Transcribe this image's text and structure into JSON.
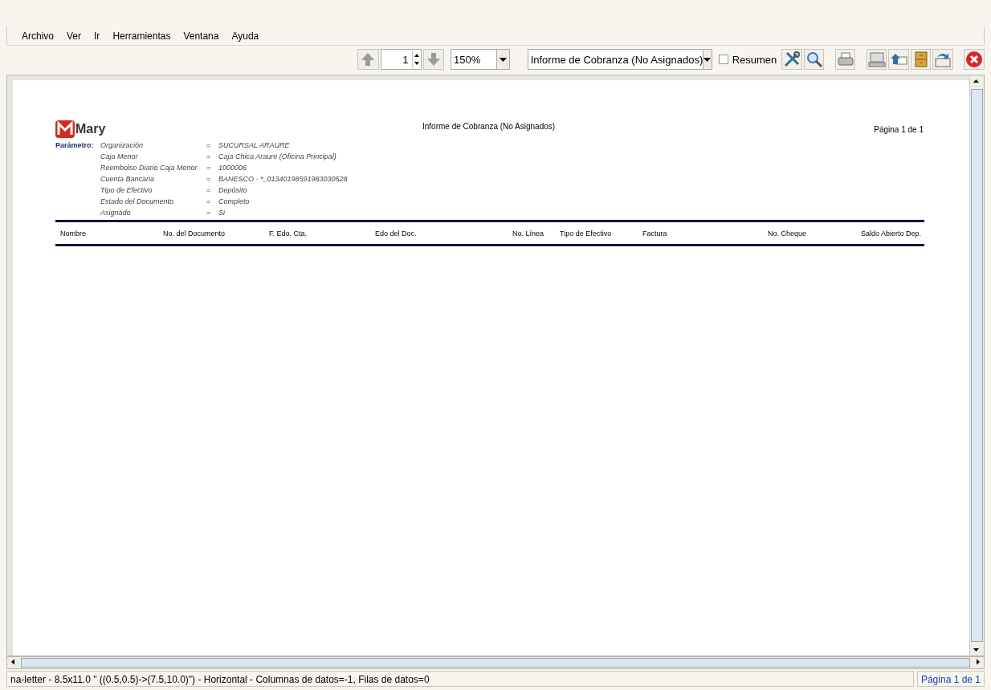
{
  "menu": [
    "Archivo",
    "Ver",
    "Ir",
    "Herramientas",
    "Ventana",
    "Ayuda"
  ],
  "toolbar": {
    "page": "1",
    "zoom": "150%",
    "report": "Informe de Cobranza (No Asignados)",
    "summary": {
      "label": "Resumen",
      "checked": false
    }
  },
  "report": {
    "logo": "Mary",
    "title": "Informe de Cobranza (No Asignados)",
    "page": "Página 1 de 1",
    "parameter_label": "Parámetro:",
    "parameters": [
      {
        "name": "Organización",
        "operator": "=",
        "value": "SUCURSAL ARAURE"
      },
      {
        "name": "Caja Menor",
        "operator": "=",
        "value": "Caja Chica Araure (Oficina Principal)"
      },
      {
        "name": "Reembolso Diario Caja Menor",
        "operator": "=",
        "value": "1000006"
      },
      {
        "name": "Cuenta Bancaria",
        "operator": "=",
        "value": "BANESCO - *_01340198591983030528"
      },
      {
        "name": "Tipo de Efectivo",
        "operator": "=",
        "value": "Depósito"
      },
      {
        "name": "Estado del Documento",
        "operator": "=",
        "value": "Completo"
      },
      {
        "name": "Asignado",
        "operator": "=",
        "value": "Si"
      }
    ],
    "columns": [
      "Nombre",
      "No. del Documento",
      "F. Edo. Cta.",
      "Edo del Doc.",
      "No. Línea",
      "Tipo de Efectivo",
      "Factura",
      "No. Cheque",
      "Saldo Abierto Dep."
    ]
  },
  "status_bar": {
    "info": "na-letter - 8.5x11.0 \" ((0.5,0.5)->(7.5,10.0)\") - Horizontal - Columnas de datos=-1, Filas de datos=0",
    "page": "Página 1 de 1"
  }
}
